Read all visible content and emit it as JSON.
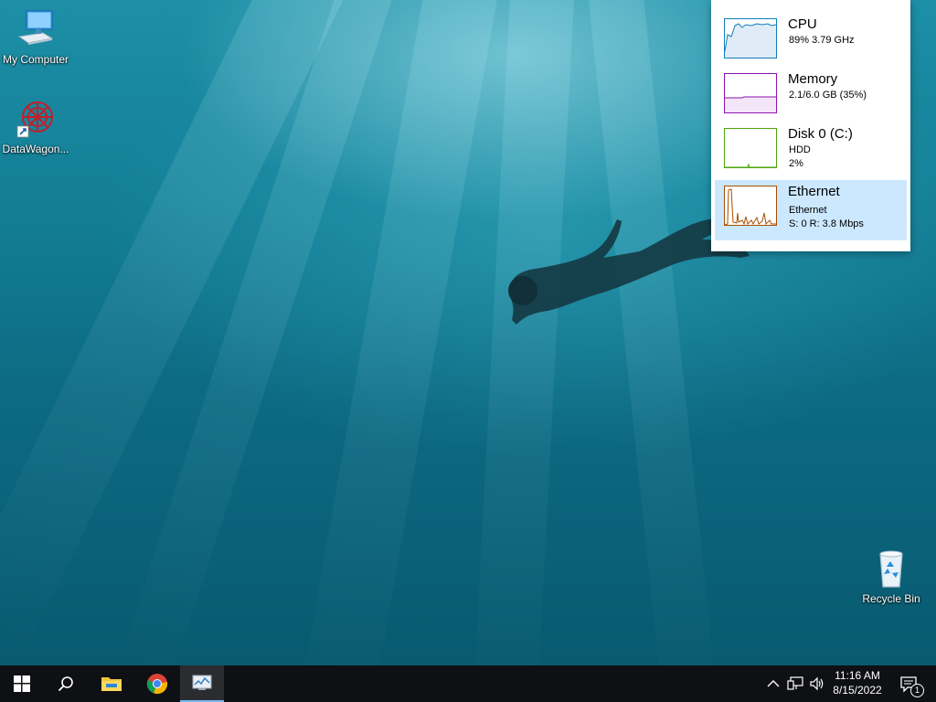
{
  "desktop": {
    "icons": [
      {
        "label": "My Computer"
      },
      {
        "label": "DataWagon..."
      },
      {
        "label": "Recycle Bin"
      }
    ]
  },
  "perf_panel": {
    "items": [
      {
        "title": "CPU",
        "line1": "89% 3.79 GHz",
        "line2": "",
        "color": "#117dbb"
      },
      {
        "title": "Memory",
        "line1": "2.1/6.0 GB (35%)",
        "line2": "",
        "color": "#8b12ae"
      },
      {
        "title": "Disk 0 (C:)",
        "line1": "HDD",
        "line2": "2%",
        "color": "#4da60c"
      },
      {
        "title": "Ethernet",
        "line1": "Ethernet",
        "line2": "S: 0 R: 3.8 Mbps",
        "color": "#a74f01"
      }
    ],
    "selected": "Ethernet"
  },
  "taskbar": {
    "apps": [
      "start-icon",
      "search-icon",
      "file-explorer-icon",
      "chrome-icon",
      "task-manager-icon"
    ],
    "clock_time": "11:16 AM",
    "clock_date": "8/15/2022",
    "notification_count": "1"
  }
}
